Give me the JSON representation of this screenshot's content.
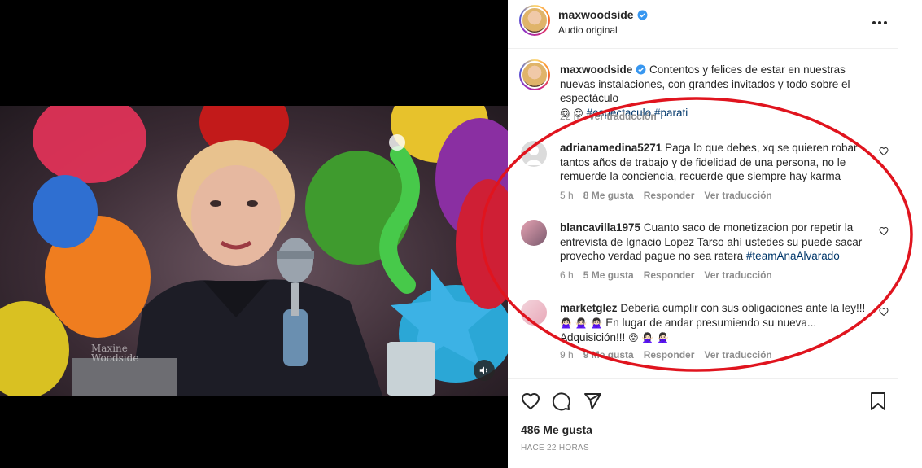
{
  "post": {
    "author": "maxwoodside",
    "audio": "Audio original",
    "caption_text": "Contentos y felices de estar en nuestras nuevas instalaciones, con grandes invitados y todo sobre el espectáculo",
    "caption_emojis": "😍 😍",
    "hashtags": [
      "#espectaculo",
      "#parati"
    ],
    "caption_time": "22 h",
    "caption_translate": "Ver traducción"
  },
  "video": {
    "mute_icon": "speaker-icon",
    "watermark_line1": "Maxine",
    "watermark_line2": "Woodside"
  },
  "comments": [
    {
      "user": "adrianamedina5271",
      "text": "Paga lo que debes, xq se quieren robar tantos años de trabajo y de fidelidad de una persona, no le remuerde la conciencia, recuerde que siempre hay karma",
      "time": "5 h",
      "likes": "8 Me gusta",
      "reply": "Responder",
      "translate": "Ver traducción"
    },
    {
      "user": "blancavilla1975",
      "text": "Cuanto saco de monetizacion por repetir la entrevista de Ignacio Lopez Tarso ahí ustedes su puede sacar provecho verdad pague no sea ratera",
      "hashtag": "#teamAnaAlvarado",
      "time": "6 h",
      "likes": "5 Me gusta",
      "reply": "Responder",
      "translate": "Ver traducción"
    },
    {
      "user": "marketglez",
      "text": "Debería cumplir con sus obligaciones ante la ley!!!",
      "text2": "En lugar de andar presumiendo su nueva...",
      "text3": "Adquisición!!!",
      "emojis_a": "🙅🏻‍♀️ 🙅🏻‍♀️ 🙅🏻‍♀️",
      "emojis_b": "😡 🙅🏻‍♀️ 🙅🏻‍♀️",
      "time": "9 h",
      "likes": "9 Me gusta",
      "reply": "Responder",
      "translate": "Ver traducción"
    }
  ],
  "footer": {
    "likes": "486 Me gusta",
    "time": "HACE 22 HORAS"
  },
  "colors": {
    "verified": "#3897f0",
    "annotation": "#e0141e",
    "hashtag": "#00376b"
  }
}
